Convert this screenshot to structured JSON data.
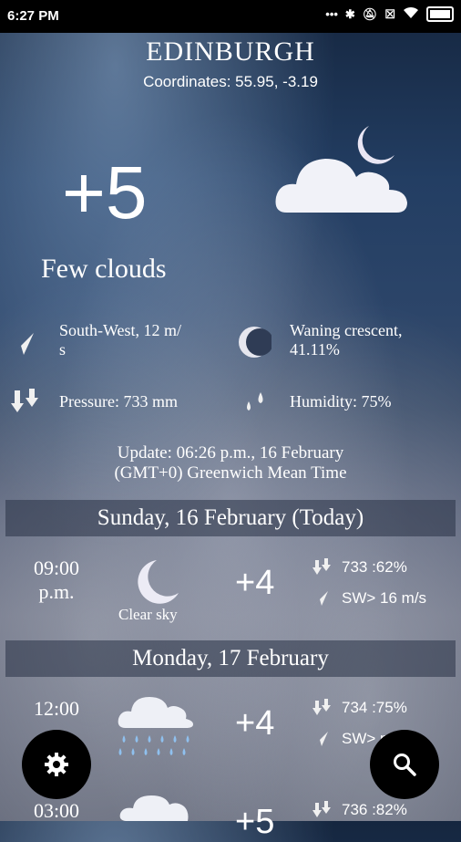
{
  "status": {
    "time": "6:27 PM"
  },
  "header": {
    "city": "EDINBURGH",
    "coordinates": "Coordinates: 55.95, -3.19"
  },
  "current": {
    "temperature": "+5",
    "condition": "Few clouds",
    "wind_line1": "South-West,  12 m/",
    "wind_line2": "s",
    "moon_line1": "Waning crescent,",
    "moon_line2": "41.11%",
    "pressure": "Pressure: 733 mm",
    "humidity": "Humidity: 75%",
    "update_line1": "Update: 06:26 p.m., 16 February",
    "update_line2": "(GMT+0) Greenwich Mean Time"
  },
  "days": [
    {
      "header": "Sunday, 16 February (Today)",
      "entries": [
        {
          "time1": "09:00",
          "time2": "p.m.",
          "icon": "moon-icon",
          "caption": "Clear sky",
          "temp": "+4",
          "pressure_humidity": "733 :62%",
          "wind": "SW> 16 m/s"
        }
      ]
    },
    {
      "header": "Monday, 17 February",
      "entries": [
        {
          "time1": "12:00",
          "time2": "",
          "icon": "rain-cloud-icon",
          "caption": "",
          "temp": "+4",
          "pressure_humidity": "734 :75%",
          "wind": "SW> m/s"
        },
        {
          "time1": "03:00",
          "time2": "",
          "icon": "cloud-moon-icon",
          "caption": "",
          "temp": "+5",
          "pressure_humidity": "736 :82%",
          "wind": ""
        }
      ]
    }
  ],
  "fabs": {
    "settings": "gear-icon",
    "search": "search-icon"
  }
}
